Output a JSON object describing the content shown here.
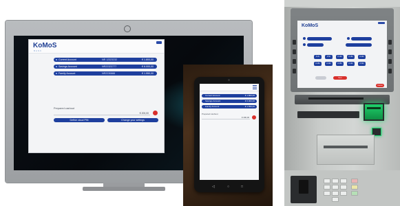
{
  "colors": {
    "brand_blue": "#1e3f9e",
    "accent_red": "#d9302c",
    "atm_green": "#1ecf6a"
  },
  "monitor": {
    "camera_icon": "circle-icon"
  },
  "desktop_app": {
    "logo": "KoMoS",
    "logo_sub": "BANK",
    "accounts": [
      {
        "name": "Current Account",
        "number": "NR 12323232",
        "amount": "€ 1.800,00"
      },
      {
        "name": "Savings Account",
        "number": "NR22323777",
        "amount": "€ 6.000,00"
      },
      {
        "name": "Family Account",
        "number": "NR2230888",
        "amount": "€ 1.550,00"
      }
    ],
    "prepared_label": "Prepared cashout",
    "prepared_amount": "€ 200,00",
    "buttons": {
      "left": "Define cloud PIN",
      "right": "Change your settings"
    }
  },
  "tablet_app": {
    "accounts": [
      {
        "name": "Current Account",
        "amount": "€ 1.800,00"
      },
      {
        "name": "Savings Account",
        "amount": "€ 6.000,00"
      },
      {
        "name": "Family Account",
        "amount": "€ 1.550,00"
      }
    ],
    "prepared_label": "Prepared cashout",
    "prepared_amount": "€ 200,00"
  },
  "atm_app": {
    "logo": "KoMoS",
    "amount_buttons": [
      "€ 20",
      "€ 50",
      "€ 100",
      "€ 150",
      "€ 200",
      "€ 250",
      "€ 300",
      "€ 350",
      "€ 400",
      "€ 500"
    ],
    "next_label": "Next",
    "cancel_label": "Cancel"
  }
}
